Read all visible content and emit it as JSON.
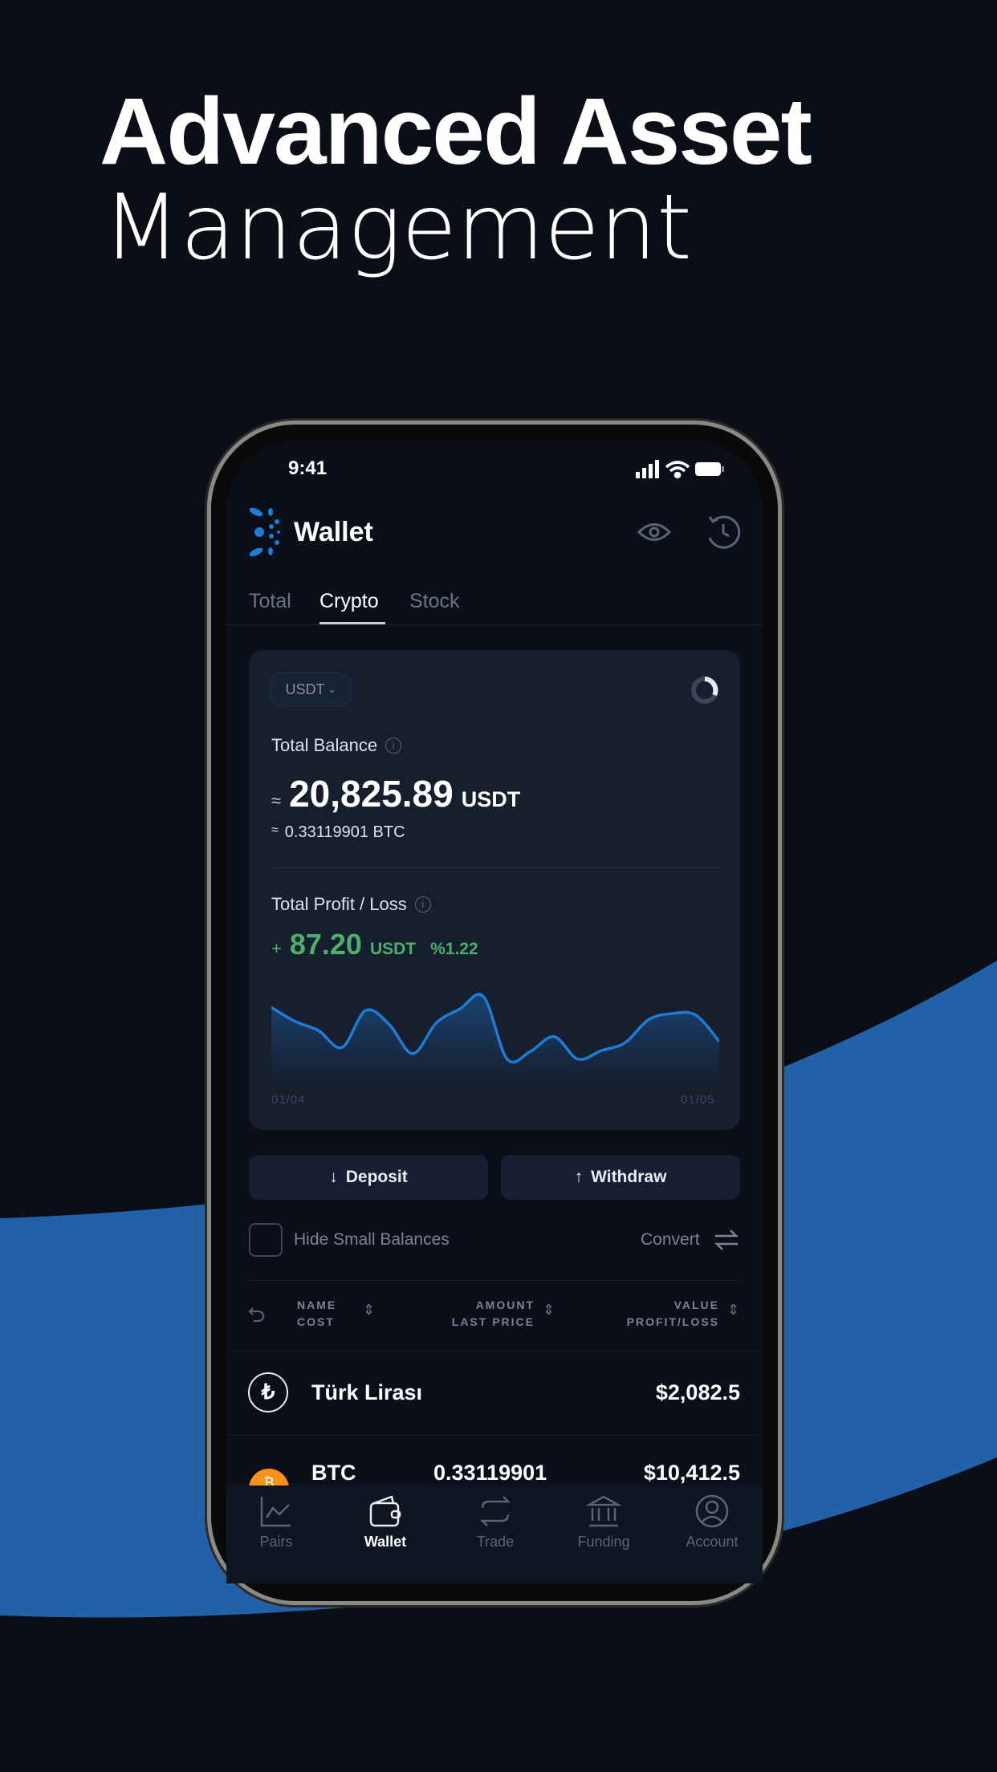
{
  "headline": {
    "line1": "Advanced Asset",
    "line2": "Management"
  },
  "colors": {
    "background": "#0c0e17",
    "swoosh": "#2260a8",
    "accent_blue": "#1e7bd6",
    "profit_green": "#4caf6a"
  },
  "status_bar": {
    "time": "9:41",
    "icons": [
      "signal-icon",
      "wifi-icon",
      "battery-icon"
    ]
  },
  "header": {
    "title": "Wallet",
    "icons": [
      "eye-icon",
      "history-icon"
    ]
  },
  "tabs": [
    {
      "label": "Total",
      "active": false
    },
    {
      "label": "Crypto",
      "active": true
    },
    {
      "label": "Stock",
      "active": false
    }
  ],
  "balance_card": {
    "currency_select": "USDT",
    "total_balance_label": "Total Balance",
    "approx": "≈",
    "total_balance_value": "20,825.89",
    "total_balance_unit": "USDT",
    "btc_equivalent": "0.33119901 BTC",
    "pnl_label": "Total Profit / Loss",
    "pnl_sign": "+",
    "pnl_value": "87.20",
    "pnl_unit": "USDT",
    "pnl_percent": "%1.22"
  },
  "chart_data": {
    "type": "area",
    "x_start_label": "01/04",
    "x_end_label": "01/05",
    "values": [
      82,
      64,
      52,
      30,
      78,
      60,
      22,
      62,
      80,
      96,
      15,
      25,
      44,
      15,
      26,
      36,
      66,
      74,
      72,
      38
    ],
    "grid": false
  },
  "actions": {
    "deposit": "Deposit",
    "withdraw": "Withdraw"
  },
  "filters": {
    "hide_small": "Hide Small Balances",
    "hide_small_checked": false,
    "convert": "Convert"
  },
  "table": {
    "headers": [
      {
        "top": "NAME",
        "bottom": "COST"
      },
      {
        "top": "AMOUNT",
        "bottom": "LAST PRICE"
      },
      {
        "top": "VALUE",
        "bottom": "PROFIT/LOSS"
      }
    ],
    "rows": [
      {
        "name": "Türk Lirası",
        "amount": "",
        "value": "$2,082.5",
        "icon": "lira-icon"
      },
      {
        "name": "BTC",
        "amount": "0.33119901",
        "value": "$10,412.5",
        "icon": "bitcoin-icon"
      }
    ]
  },
  "bottom_nav": [
    {
      "label": "Pairs",
      "icon": "chart-icon",
      "active": false
    },
    {
      "label": "Wallet",
      "icon": "wallet-icon",
      "active": true
    },
    {
      "label": "Trade",
      "icon": "swap-icon",
      "active": false
    },
    {
      "label": "Funding",
      "icon": "bank-icon",
      "active": false
    },
    {
      "label": "Account",
      "icon": "user-icon",
      "active": false
    }
  ]
}
